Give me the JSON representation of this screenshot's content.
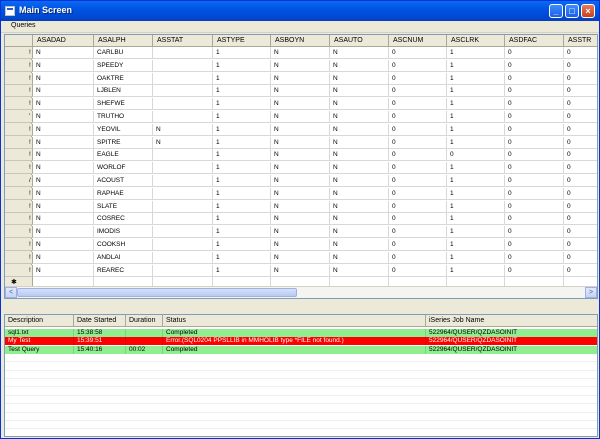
{
  "window": {
    "title": "Main Screen",
    "controls": {
      "minimize": "_",
      "maximize": "□",
      "close": "×"
    }
  },
  "menu": {
    "items": [
      "Queries"
    ]
  },
  "grid": {
    "columns": [
      "ASADAD",
      "ASALPH",
      "ASSTAT",
      "ASTYPE",
      "ASBOYN",
      "ASAUTO",
      "ASCNUM",
      "ASCLRK",
      "ASDFAC",
      "ASSTR"
    ],
    "rowheader_marks": [
      "!",
      "!",
      "!",
      "!",
      "!",
      "'",
      "!",
      "!",
      "!",
      "!",
      "/",
      "!",
      "!",
      "!",
      "!",
      "!",
      "!",
      "!",
      "!"
    ],
    "rows": [
      [
        "N",
        "CARLBU",
        "",
        "1",
        "N",
        "N",
        "0",
        "1",
        "0",
        "0"
      ],
      [
        "N",
        "SPEEDY",
        "",
        "1",
        "N",
        "N",
        "0",
        "1",
        "0",
        "0"
      ],
      [
        "N",
        "OAKTRE",
        "",
        "1",
        "N",
        "N",
        "0",
        "1",
        "0",
        "0"
      ],
      [
        "N",
        "LJBLEN",
        "",
        "1",
        "N",
        "N",
        "0",
        "1",
        "0",
        "0"
      ],
      [
        "N",
        "SHEFWE",
        "",
        "1",
        "N",
        "N",
        "0",
        "1",
        "0",
        "0"
      ],
      [
        "N",
        "TRUTHO",
        "",
        "1",
        "N",
        "N",
        "0",
        "1",
        "0",
        "0"
      ],
      [
        "N",
        "YEOVIL",
        "N",
        "1",
        "N",
        "N",
        "0",
        "1",
        "0",
        "0"
      ],
      [
        "N",
        "SPITRE",
        "N",
        "1",
        "N",
        "N",
        "0",
        "1",
        "0",
        "0"
      ],
      [
        "N",
        "EAGLE",
        "",
        "1",
        "N",
        "N",
        "0",
        "0",
        "0",
        "0"
      ],
      [
        "N",
        "WORLOF",
        "",
        "1",
        "N",
        "N",
        "0",
        "1",
        "0",
        "0"
      ],
      [
        "N",
        "ACOUST",
        "",
        "1",
        "N",
        "N",
        "0",
        "1",
        "0",
        "0"
      ],
      [
        "N",
        "RAPHAE",
        "",
        "1",
        "N",
        "N",
        "0",
        "1",
        "0",
        "0"
      ],
      [
        "N",
        "SLATE",
        "",
        "1",
        "N",
        "N",
        "0",
        "1",
        "0",
        "0"
      ],
      [
        "N",
        "COSREC",
        "",
        "1",
        "N",
        "N",
        "0",
        "1",
        "0",
        "0"
      ],
      [
        "N",
        "IMODIS",
        "",
        "1",
        "N",
        "N",
        "0",
        "1",
        "0",
        "0"
      ],
      [
        "N",
        "COOKSH",
        "",
        "1",
        "N",
        "N",
        "0",
        "1",
        "0",
        "0"
      ],
      [
        "N",
        "ANDLAI",
        "",
        "1",
        "N",
        "N",
        "0",
        "1",
        "0",
        "0"
      ],
      [
        "N",
        "REAREC",
        "",
        "1",
        "N",
        "N",
        "0",
        "1",
        "0",
        "0"
      ]
    ],
    "new_row_marker": "✱"
  },
  "scroll": {
    "left_arrow": "<",
    "right_arrow": ">"
  },
  "log": {
    "columns": [
      "Description",
      "Date Started",
      "Duration",
      "Status",
      "iSeries Job Name"
    ],
    "rows": [
      {
        "description": "sql1.txt",
        "date_started": "15:38:58",
        "duration": "",
        "status": "Completed",
        "job": "522964/QUSER/QZDASOINIT",
        "color": "#90ee90",
        "text_color": "#000000"
      },
      {
        "description": "My Test",
        "date_started": "15:39:51",
        "duration": "",
        "status": "Error.(SQL0204 PPSLLIB in MMHOLIB type *FILE not found.)",
        "job": "522964/QUSER/QZDASOINIT",
        "color": "#ff0000",
        "text_color": "#ffffff"
      },
      {
        "description": "Test Query",
        "date_started": "15:40:16",
        "duration": "00:02",
        "status": "Completed",
        "job": "522964/QUSER/QZDASOINIT",
        "color": "#90ee90",
        "text_color": "#000000"
      }
    ]
  }
}
